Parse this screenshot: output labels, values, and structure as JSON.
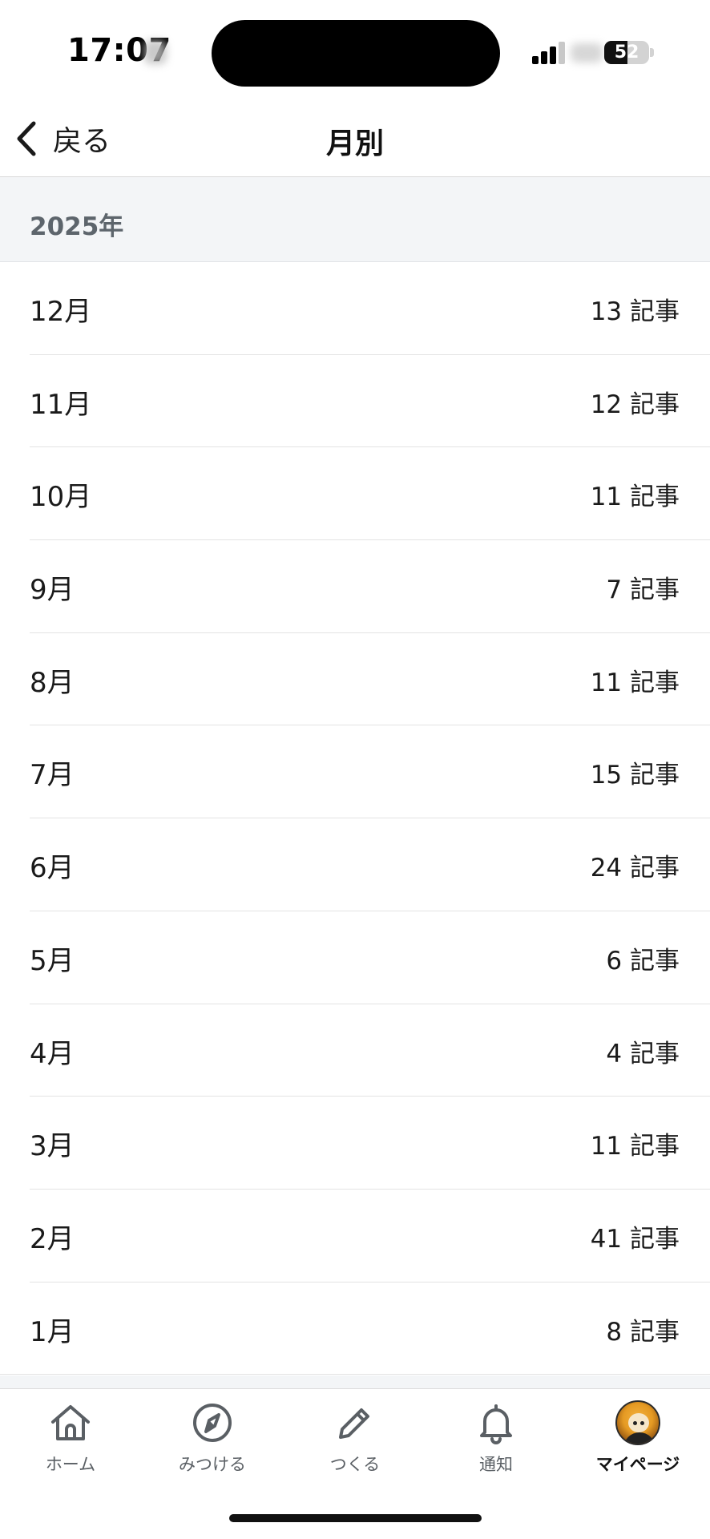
{
  "status_bar": {
    "time": "17:07",
    "battery_level": "52",
    "battery_fraction": 0.52
  },
  "header": {
    "back_label": "戻る",
    "title": "月別"
  },
  "section": {
    "year": "2025年"
  },
  "months": [
    {
      "label": "12月",
      "count": "13 記事"
    },
    {
      "label": "11月",
      "count": "12 記事"
    },
    {
      "label": "10月",
      "count": "11 記事"
    },
    {
      "label": "9月",
      "count": "7 記事"
    },
    {
      "label": "8月",
      "count": "11 記事"
    },
    {
      "label": "7月",
      "count": "15 記事"
    },
    {
      "label": "6月",
      "count": "24 記事"
    },
    {
      "label": "5月",
      "count": "6 記事"
    },
    {
      "label": "4月",
      "count": "4 記事"
    },
    {
      "label": "3月",
      "count": "11 記事"
    },
    {
      "label": "2月",
      "count": "41 記事"
    },
    {
      "label": "1月",
      "count": "8 記事"
    }
  ],
  "tabs": [
    {
      "label": "ホーム",
      "icon": "home-icon"
    },
    {
      "label": "みつける",
      "icon": "compass-icon"
    },
    {
      "label": "つくる",
      "icon": "pencil-icon"
    },
    {
      "label": "通知",
      "icon": "bell-icon"
    },
    {
      "label": "マイページ",
      "icon": "avatar",
      "active": true
    }
  ],
  "colors": {
    "section_bg": "#f3f5f7",
    "year_text": "#5d656c",
    "tab_inactive": "#5a5f64",
    "text": "#1a1a1a"
  }
}
